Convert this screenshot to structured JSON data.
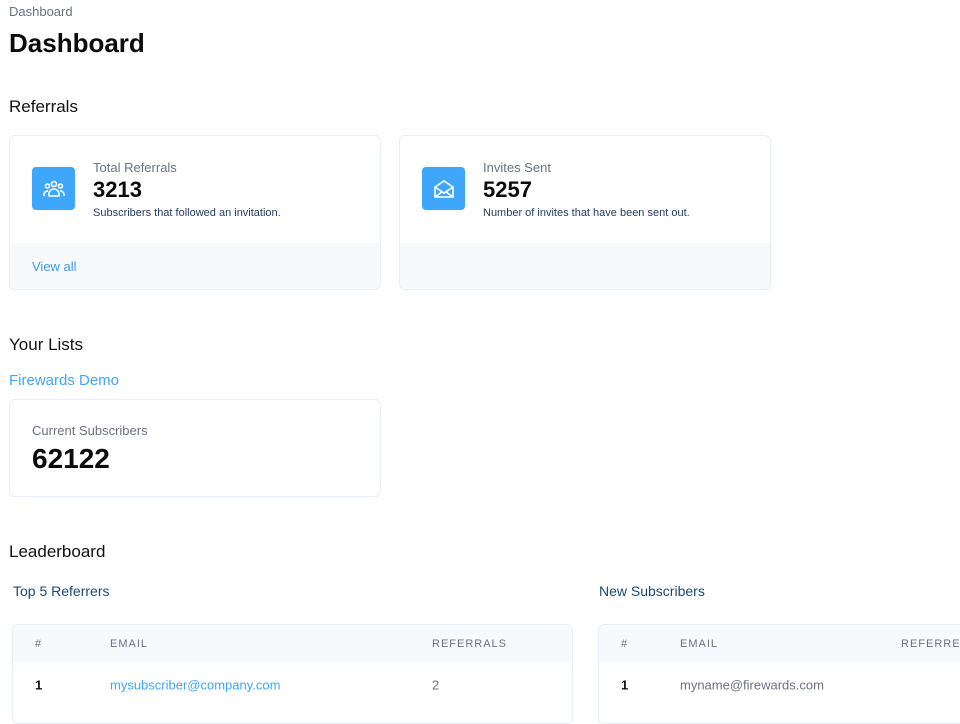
{
  "breadcrumb": "Dashboard",
  "title": "Dashboard",
  "referrals": {
    "heading": "Referrals",
    "cards": [
      {
        "icon": "user-group-icon",
        "label": "Total Referrals",
        "value": "3213",
        "desc": "Subscribers that followed an invitation.",
        "link": "View all"
      },
      {
        "icon": "envelope-open-icon",
        "label": "Invites Sent",
        "value": "5257",
        "desc": "Number of invites that have been sent out."
      }
    ]
  },
  "lists": {
    "heading": "Your Lists",
    "list_name": "Firewards Demo",
    "label": "Current Subscribers",
    "value": "62122"
  },
  "leaderboard": {
    "heading": "Leaderboard",
    "top": {
      "title": "Top 5 Referrers",
      "columns": [
        "#",
        "EMAIL",
        "REFERRALS"
      ],
      "rows": [
        [
          "1",
          "mysubscriber@company.com",
          "2"
        ]
      ]
    },
    "new": {
      "title": "New Subscribers",
      "columns": [
        "#",
        "EMAIL",
        "REFERRED"
      ],
      "rows": [
        [
          "1",
          "myname@firewards.com"
        ]
      ]
    }
  },
  "colors": {
    "accent": "#3ea6fb",
    "link": "#3b9bea"
  }
}
